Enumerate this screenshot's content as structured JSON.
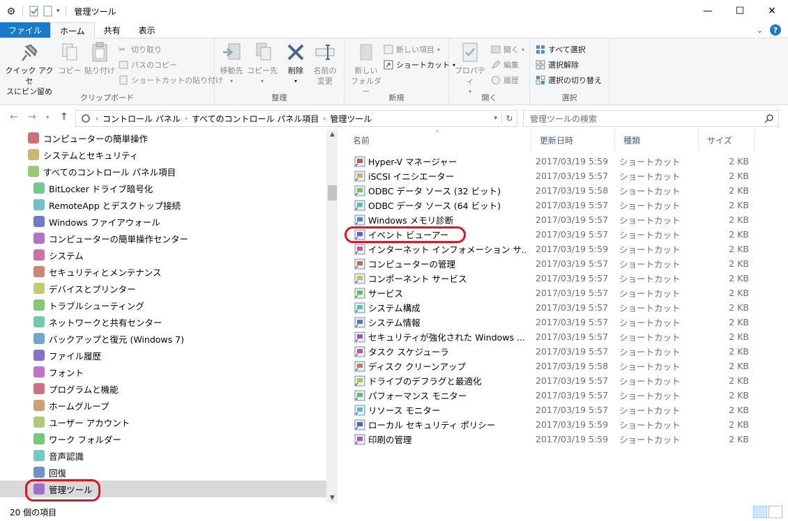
{
  "window": {
    "title": "管理ツール",
    "buttons": [
      "—",
      "☐",
      "✕"
    ]
  },
  "ribbon": {
    "tabs": [
      {
        "label": "ファイル"
      },
      {
        "label": "ホーム"
      },
      {
        "label": "共有"
      },
      {
        "label": "表示"
      }
    ],
    "help": "?",
    "groups": {
      "clipboard": {
        "label": "クリップボード",
        "pin": "クイック アクセ\nスにピン留め",
        "copy": "コピー",
        "paste": "貼り付け",
        "cut": "切り取り",
        "copy_path": "パスのコピー",
        "paste_shortcut": "ショートカットの貼り付け"
      },
      "organize": {
        "label": "整理",
        "move": "移動先",
        "copy_to": "コピー先",
        "delete": "削除",
        "rename": "名前の\n変更"
      },
      "new": {
        "label": "新規",
        "new_folder": "新しい\nフォルダー",
        "new_item": "新しい項目",
        "shortcut": "ショートカット"
      },
      "open": {
        "label": "開く",
        "properties": "プロパティ",
        "open": "開く",
        "edit": "編集",
        "history": "履歴"
      },
      "select": {
        "label": "選択",
        "select_all": "すべて選択",
        "select_none": "選択解除",
        "invert": "選択の切り替え"
      }
    }
  },
  "address": {
    "crumbs": [
      "コントロール パネル",
      "すべてのコントロール パネル項目",
      "管理ツール"
    ],
    "search_placeholder": "管理ツールの検索"
  },
  "nav": {
    "items": [
      {
        "label": "コンピューターの簡単操作",
        "icon": "ease-of-access-icon"
      },
      {
        "label": "システムとセキュリティ",
        "icon": "shield-icon"
      },
      {
        "label": "すべてのコントロール パネル項目",
        "icon": "control-panel-icon"
      },
      {
        "label": "BitLocker ドライブ暗号化",
        "icon": "bitlocker-icon"
      },
      {
        "label": "RemoteApp とデスクトップ接続",
        "icon": "remoteapp-icon"
      },
      {
        "label": "Windows ファイアウォール",
        "icon": "firewall-icon"
      },
      {
        "label": "コンピューターの簡単操作センター",
        "icon": "ease-center-icon"
      },
      {
        "label": "システム",
        "icon": "system-icon"
      },
      {
        "label": "セキュリティとメンテナンス",
        "icon": "flag-icon"
      },
      {
        "label": "デバイスとプリンター",
        "icon": "printer-icon"
      },
      {
        "label": "トラブルシューティング",
        "icon": "troubleshoot-icon"
      },
      {
        "label": "ネットワークと共有センター",
        "icon": "network-icon"
      },
      {
        "label": "バックアップと復元 (Windows 7)",
        "icon": "backup-icon"
      },
      {
        "label": "ファイル履歴",
        "icon": "file-history-icon"
      },
      {
        "label": "フォント",
        "icon": "font-icon"
      },
      {
        "label": "プログラムと機能",
        "icon": "programs-icon"
      },
      {
        "label": "ホームグループ",
        "icon": "homegroup-icon"
      },
      {
        "label": "ユーザー アカウント",
        "icon": "user-accounts-icon"
      },
      {
        "label": "ワーク フォルダー",
        "icon": "work-folders-icon"
      },
      {
        "label": "音声認識",
        "icon": "microphone-icon"
      },
      {
        "label": "回復",
        "icon": "recovery-icon"
      },
      {
        "label": "管理ツール",
        "icon": "admin-tools-icon",
        "selected": true
      }
    ]
  },
  "filelist": {
    "columns": [
      "名前",
      "更新日時",
      "種類",
      "サイズ"
    ],
    "rows": [
      {
        "name": "Hyper-V マネージャー",
        "date": "2017/03/19 5:59",
        "type": "ショートカット",
        "size": "2 KB"
      },
      {
        "name": "iSCSI イニシエーター",
        "date": "2017/03/19 5:57",
        "type": "ショートカット",
        "size": "2 KB"
      },
      {
        "name": "ODBC データ ソース (32 ビット)",
        "date": "2017/03/19 5:58",
        "type": "ショートカット",
        "size": "2 KB"
      },
      {
        "name": "ODBC データ ソース (64 ビット)",
        "date": "2017/03/19 5:57",
        "type": "ショートカット",
        "size": "2 KB"
      },
      {
        "name": "Windows メモリ診断",
        "date": "2017/03/19 5:57",
        "type": "ショートカット",
        "size": "2 KB"
      },
      {
        "name": "イベント ビューアー",
        "date": "2017/03/19 5:57",
        "type": "ショートカット",
        "size": "2 KB"
      },
      {
        "name": "インターネット インフォメーション サ...",
        "date": "2017/03/19 5:59",
        "type": "ショートカット",
        "size": "2 KB"
      },
      {
        "name": "コンピューターの管理",
        "date": "2017/03/19 5:57",
        "type": "ショートカット",
        "size": "2 KB"
      },
      {
        "name": "コンポーネント サービス",
        "date": "2017/03/19 5:57",
        "type": "ショートカット",
        "size": "2 KB"
      },
      {
        "name": "サービス",
        "date": "2017/03/19 5:57",
        "type": "ショートカット",
        "size": "2 KB"
      },
      {
        "name": "システム構成",
        "date": "2017/03/19 5:57",
        "type": "ショートカット",
        "size": "2 KB"
      },
      {
        "name": "システム情報",
        "date": "2017/03/19 5:57",
        "type": "ショートカット",
        "size": "2 KB"
      },
      {
        "name": "セキュリティが強化された Windows ...",
        "date": "2017/03/19 5:57",
        "type": "ショートカット",
        "size": "2 KB"
      },
      {
        "name": "タスク スケジューラ",
        "date": "2017/03/19 5:57",
        "type": "ショートカット",
        "size": "2 KB"
      },
      {
        "name": "ディスク クリーンアップ",
        "date": "2017/03/19 5:58",
        "type": "ショートカット",
        "size": "2 KB"
      },
      {
        "name": "ドライブのデフラグと最適化",
        "date": "2017/03/19 5:57",
        "type": "ショートカット",
        "size": "2 KB"
      },
      {
        "name": "パフォーマンス モニター",
        "date": "2017/03/19 5:57",
        "type": "ショートカット",
        "size": "2 KB"
      },
      {
        "name": "リソース モニター",
        "date": "2017/03/19 5:57",
        "type": "ショートカット",
        "size": "2 KB"
      },
      {
        "name": "ローカル セキュリティ ポリシー",
        "date": "2017/03/19 5:59",
        "type": "ショートカット",
        "size": "2 KB"
      },
      {
        "name": "印刷の管理",
        "date": "2017/03/19 5:59",
        "type": "ショートカット",
        "size": "2 KB"
      }
    ]
  },
  "status": {
    "count": "20 個の項目"
  },
  "colors": {
    "file_tab": "#1979ca",
    "highlight": "#e4141e",
    "selection": "#d9d9d9"
  }
}
